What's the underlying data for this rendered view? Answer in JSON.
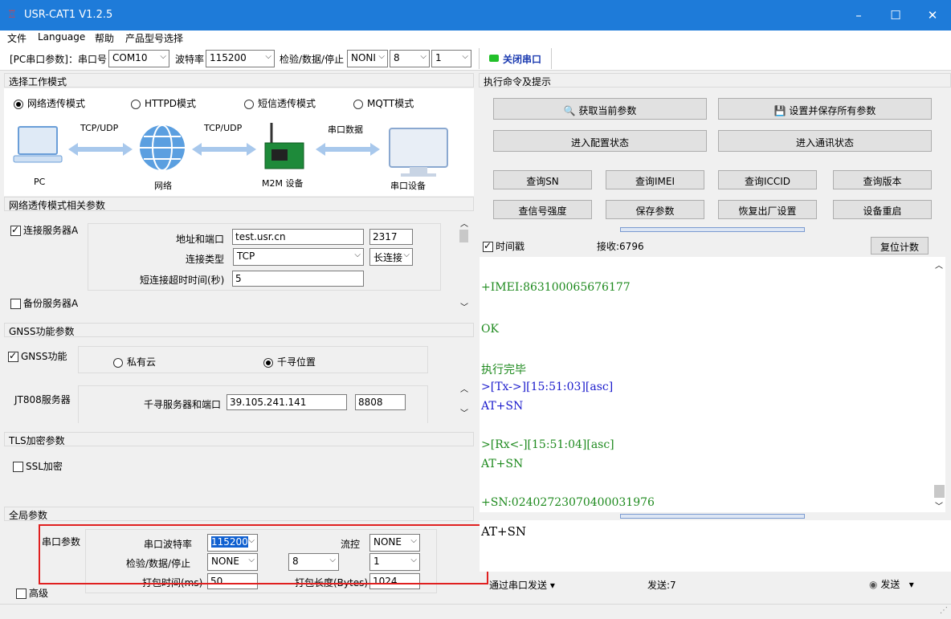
{
  "window": {
    "title": "USR-CAT1 V1.2.5",
    "minimize": "–",
    "maximize": "☐",
    "close": "✕"
  },
  "menu": [
    "文件",
    "Language",
    "帮助",
    "产品型号选择"
  ],
  "toolbar": {
    "pc_label": "[PC串口参数]：串口号",
    "port": "COM10",
    "baud_label": "波特率",
    "baud": "115200",
    "parity_label": "检验/数据/停止",
    "parity": "NONI",
    "data_bits": "8",
    "stop_bits": "1",
    "close_port": "关闭串口"
  },
  "left": {
    "work_mode_header": "选择工作模式",
    "modes": [
      "网络透传模式",
      "HTTPD模式",
      "短信透传模式",
      "MQTT模式"
    ],
    "diagram": {
      "pc": "PC",
      "tcp1": "TCP/UDP",
      "network": "网络",
      "tcp2": "TCP/UDP",
      "m2m": "M2M 设备",
      "serial_data": "串口数据",
      "serial_dev": "串口设备"
    },
    "net_params_header": "网络透传模式相关参数",
    "server_a": "连接服务器A",
    "addr_label": "地址和端口",
    "addr": "test.usr.cn",
    "port": "2317",
    "conn_type_label": "连接类型",
    "conn_type": "TCP",
    "conn_mode": "长连接",
    "timeout_label": "短连接超时时间(秒)",
    "timeout": "5",
    "backup_a": "备份服务器A",
    "gnss_header": "GNSS功能参数",
    "gnss_func": "GNSS功能",
    "private_cloud": "私有云",
    "qianxun": "千寻位置",
    "jt808": "JT808服务器",
    "qx_addr_label": "千寻服务器和端口",
    "qx_addr": "39.105.241.141",
    "qx_port": "8808",
    "tls_header": "TLS加密参数",
    "ssl": "SSL加密",
    "global_header": "全局参数",
    "serial_params": "串口参数",
    "baud_label": "串口波特率",
    "baud": "115200",
    "flow_label": "流控",
    "flow": "NONE",
    "parity_label": "检验/数据/停止",
    "parity": "NONE",
    "data_bits": "8",
    "stop_bits": "1",
    "pack_time_label": "打包时间(ms)",
    "pack_time": "50",
    "pack_len_label": "打包长度(Bytes)",
    "pack_len": "1024",
    "advanced": "高级"
  },
  "right": {
    "header": "执行命令及提示",
    "get_params": "获取当前参数",
    "save_all": "设置并保存所有参数",
    "enter_config": "进入配置状态",
    "enter_comm": "进入通讯状态",
    "q_sn": "查询SN",
    "q_imei": "查询IMEI",
    "q_iccid": "查询ICCID",
    "q_version": "查询版本",
    "q_signal": "查信号强度",
    "save_params": "保存参数",
    "factory": "恢复出厂设置",
    "reboot": "设备重启",
    "timestamp": "时间戳",
    "recv": "接收:6796",
    "reset_count": "复位计数",
    "log": [
      {
        "text": "+IMEI:863100065676177",
        "color": "#1e8a1e"
      },
      {
        "text": "OK",
        "color": "#1e8a1e"
      },
      {
        "text": "执行完毕",
        "color": "#1e8a1e"
      },
      {
        "text": ">[Tx->][15:51:03][asc]",
        "color": "#1a1acc"
      },
      {
        "text": "AT+SN",
        "color": "#1a1acc"
      },
      {
        "text": ">[Rx<-][15:51:04][asc]",
        "color": "#1e8a1e"
      },
      {
        "text": "AT+SN",
        "color": "#1e8a1e"
      },
      {
        "text": "+SN:02402723070400031976",
        "color": "#1e8a1e"
      }
    ],
    "input": "AT+SN",
    "send_via": "通过串口发送",
    "sent": "发送:7",
    "send": "发送"
  },
  "colors": {
    "title_bar": "#1e7bd9",
    "highlight_box": "#e02020",
    "arrow": "#a8c8ec"
  }
}
